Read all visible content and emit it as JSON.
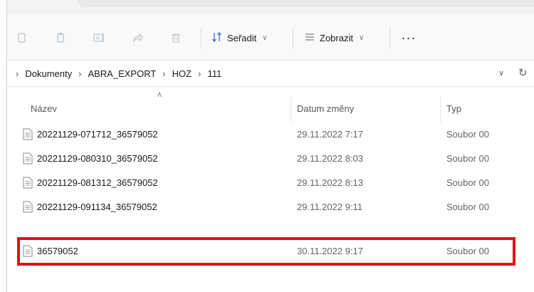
{
  "toolbar": {
    "sort_label": "Seřadit",
    "view_label": "Zobrazit",
    "more_label": "···",
    "icons": [
      "cut-icon",
      "copy-icon",
      "rename-icon",
      "share-icon",
      "delete-icon",
      "sort-icon",
      "view-icon"
    ]
  },
  "address": {
    "crumbs": [
      "Dokumenty",
      "ABRA_EXPORT",
      "HOZ",
      "111"
    ]
  },
  "columns": {
    "name": "Název",
    "date": "Datum změny",
    "type": "Typ"
  },
  "files": [
    {
      "name": "20221129-071712_36579052",
      "date": "29.11.2022 7:17",
      "type": "Soubor 00"
    },
    {
      "name": "20221129-080310_36579052",
      "date": "29.11.2022 8:03",
      "type": "Soubor 00"
    },
    {
      "name": "20221129-081312_36579052",
      "date": "29.11.2022 8:13",
      "type": "Soubor 00"
    },
    {
      "name": "20221129-091134_36579052",
      "date": "29.11.2022 9:11",
      "type": "Soubor 00"
    },
    {
      "name": "36579052",
      "date": "30.11.2022 9:17",
      "type": "Soubor 00"
    }
  ],
  "colors": {
    "highlight": "#e3101b",
    "disabled_icon": "#b9c7d6"
  }
}
